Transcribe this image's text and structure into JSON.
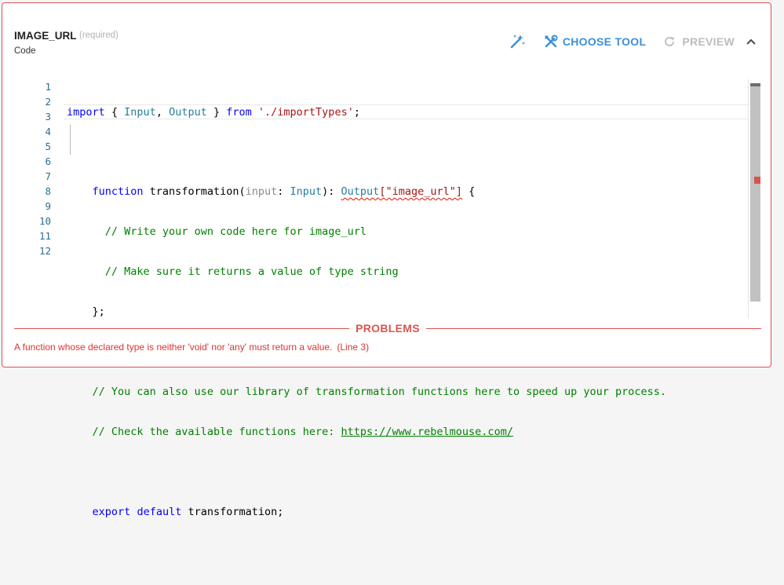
{
  "field": {
    "name": "IMAGE_URL",
    "required_label": "(required)",
    "subtitle": "Code"
  },
  "toolbar": {
    "magic_icon": "magic-wand-icon",
    "choose_tool_label": "CHOOSE TOOL",
    "choose_tool_icon": "tools-icon",
    "preview_label": "PREVIEW",
    "preview_icon": "refresh-icon",
    "collapse_icon": "chevron-up-icon",
    "accent_color": "#3d8fd6",
    "disabled_color": "#bcbcbc"
  },
  "editor": {
    "line_numbers": [
      "1",
      "2",
      "3",
      "4",
      "5",
      "6",
      "7",
      "8",
      "9",
      "10",
      "11",
      "12"
    ],
    "lines": [
      {
        "import_kw": "import",
        "brace_open": " { ",
        "input_type": "Input",
        "comma": ", ",
        "output_type": "Output",
        "brace_close": " } ",
        "from_kw": "from",
        "space": " ",
        "module": "'./importTypes'",
        "semi": ";"
      },
      {},
      {
        "indent": "    ",
        "function_kw": "function",
        "name": " transformation(",
        "param": "input",
        "colon": ": ",
        "param_type": "Input",
        "ret_sep": "): ",
        "ret_type": "Output",
        "ret_index": "[\"image_url\"]",
        "brace": " {"
      },
      {
        "indent": "      ",
        "comment": "// Write your own code here for image_url"
      },
      {
        "indent": "      ",
        "comment": "// Make sure it returns a value of type string"
      },
      {
        "indent": "    ",
        "text": "};"
      },
      {},
      {
        "indent": "    ",
        "comment": "// You can also use our library of transformation functions here to speed up your process."
      },
      {
        "indent": "    ",
        "comment": "// Check the available functions here: ",
        "link": "https://www.rebelmouse.com/"
      },
      {},
      {
        "indent": "    ",
        "export_kw": "export",
        "space": " ",
        "default_kw": "default",
        "name": " transformation;"
      },
      {}
    ],
    "colors": {
      "keyword": "#0000ff",
      "type": "#267f99",
      "string": "#a31515",
      "comment": "#008000",
      "error": "#e51400"
    }
  },
  "problems": {
    "title": "PROBLEMS",
    "items": [
      {
        "message": "A function whose declared type is neither 'void' nor 'any' must return a value.",
        "location": "(Line 3)"
      }
    ],
    "color": "#d9534f"
  }
}
